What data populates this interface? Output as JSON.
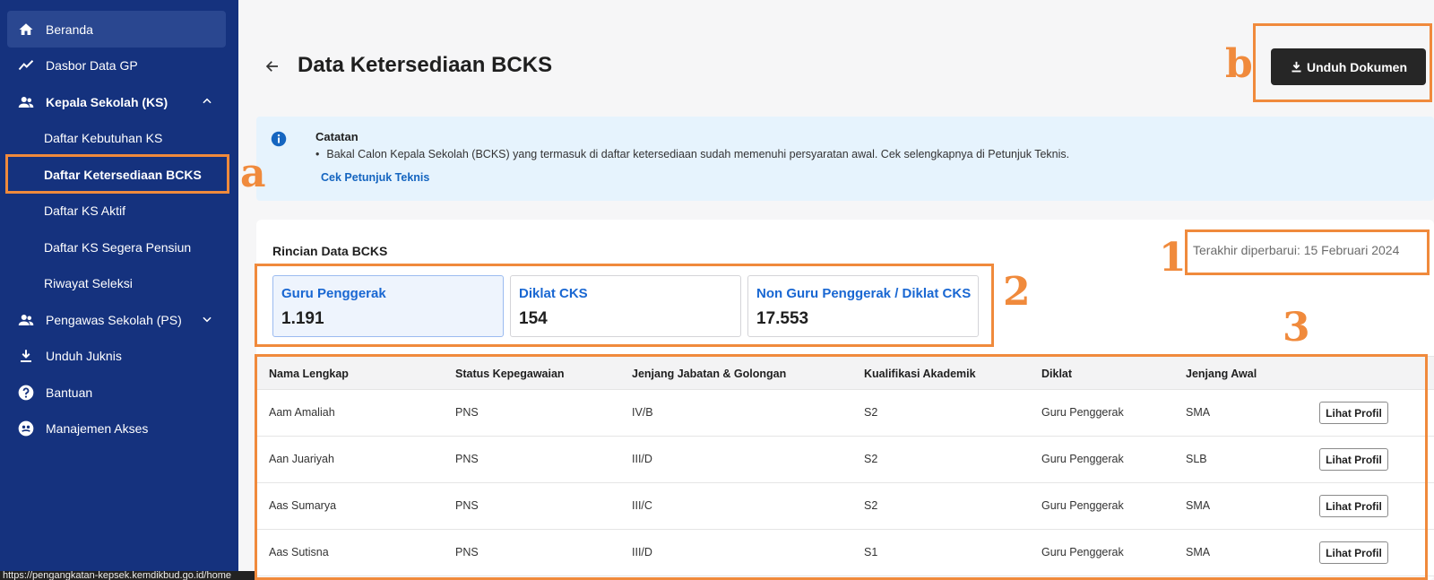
{
  "sidebar": {
    "items": [
      {
        "label": "Beranda",
        "icon": "home-icon"
      },
      {
        "label": "Dasbor Data GP",
        "icon": "chart-line-icon"
      },
      {
        "label": "Kepala Sekolah (KS)",
        "icon": "people-icon"
      },
      {
        "label": "Daftar Kebutuhan KS"
      },
      {
        "label": "Daftar Ketersediaan BCKS"
      },
      {
        "label": "Daftar KS Aktif"
      },
      {
        "label": "Daftar KS Segera Pensiun"
      },
      {
        "label": "Riwayat Seleksi"
      },
      {
        "label": "Pengawas Sekolah (PS)",
        "icon": "people-icon"
      },
      {
        "label": "Unduh Juknis",
        "icon": "download-icon"
      },
      {
        "label": "Bantuan",
        "icon": "help-icon"
      },
      {
        "label": "Manajemen Akses",
        "icon": "access-icon"
      }
    ]
  },
  "status_url": "https://pengangkatan-kepsek.kemdikbud.go.id/home",
  "header": {
    "title": "Data Ketersediaan BCKS",
    "download_label": "Unduh Dokumen"
  },
  "note": {
    "title": "Catatan",
    "text": "Bakal Calon Kepala Sekolah (BCKS) yang termasuk di daftar ketersediaan sudah memenuhi persyaratan awal. Cek selengkapnya di Petunjuk Teknis.",
    "link": "Cek Petunjuk Teknis"
  },
  "details": {
    "title": "Rincian Data BCKS",
    "updated": "Terakhir diperbarui: 15 Februari 2024",
    "stats": [
      {
        "label": "Guru Penggerak",
        "value": "1.191"
      },
      {
        "label": "Diklat CKS",
        "value": "154"
      },
      {
        "label": "Non Guru Penggerak / Diklat CKS",
        "value": "17.553"
      }
    ]
  },
  "table": {
    "headers": [
      "Nama Lengkap",
      "Status Kepegawaian",
      "Jenjang Jabatan & Golongan",
      "Kualifikasi Akademik",
      "Diklat",
      "Jenjang Awal"
    ],
    "button_label": "Lihat Profil",
    "rows": [
      [
        "Aam Amaliah",
        "PNS",
        "IV/B",
        "S2",
        "Guru Penggerak",
        "SMA"
      ],
      [
        "Aan Juariyah",
        "PNS",
        "III/D",
        "S2",
        "Guru Penggerak",
        "SLB"
      ],
      [
        "Aas Sumarya",
        "PNS",
        "III/C",
        "S2",
        "Guru Penggerak",
        "SMA"
      ],
      [
        "Aas Sutisna",
        "PNS",
        "III/D",
        "S1",
        "Guru Penggerak",
        "SMA"
      ]
    ]
  },
  "annotations": {
    "a": "a",
    "b": "b",
    "n1": "1",
    "n2": "2",
    "n3": "3"
  },
  "colors": {
    "sidebar": "#15327e",
    "accent": "#1967d2",
    "annotation": "#f08a3c"
  }
}
